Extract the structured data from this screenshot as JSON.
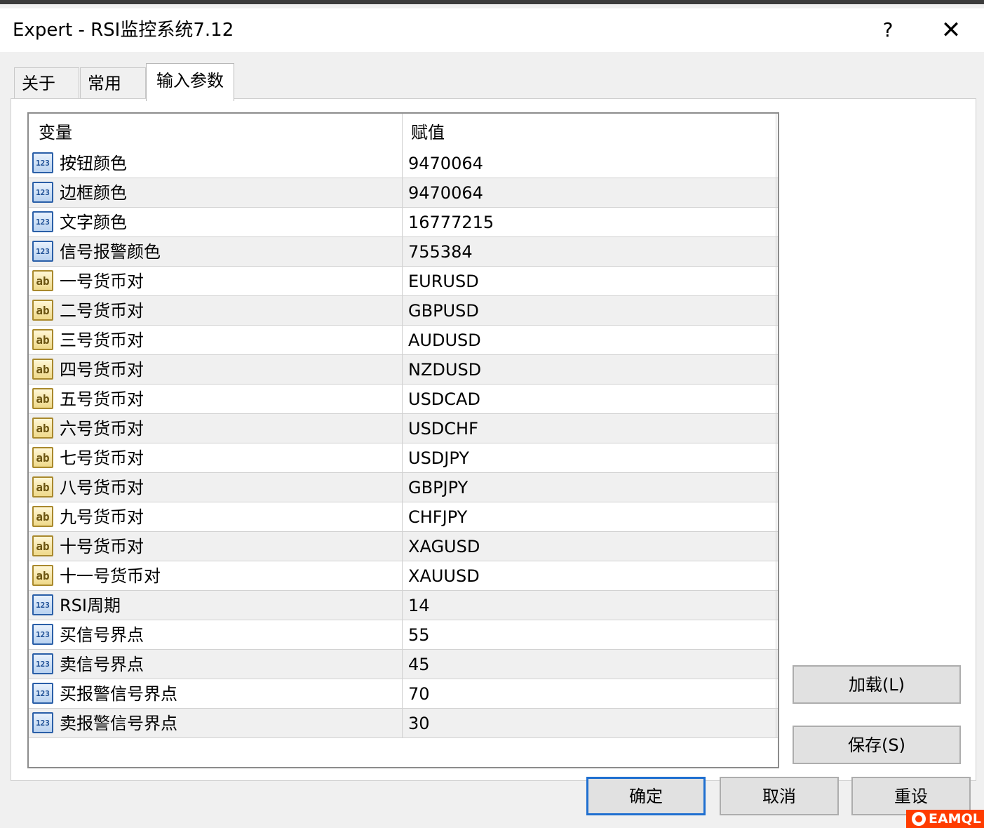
{
  "window": {
    "title": "Expert - RSI监控系统7.12",
    "help_label": "?",
    "close_label": "✕"
  },
  "tabs": [
    {
      "label": "关于"
    },
    {
      "label": "常用"
    },
    {
      "label": "输入参数",
      "active": true
    }
  ],
  "grid": {
    "columns": {
      "variable": "变量",
      "value": "赋值"
    },
    "rows": [
      {
        "type": "num",
        "icon": "123",
        "name": "按钮颜色",
        "value": "9470064"
      },
      {
        "type": "num",
        "icon": "123",
        "name": "边框颜色",
        "value": "9470064"
      },
      {
        "type": "num",
        "icon": "123",
        "name": "文字颜色",
        "value": "16777215"
      },
      {
        "type": "num",
        "icon": "123",
        "name": "信号报警颜色",
        "value": "755384"
      },
      {
        "type": "str",
        "icon": "ab",
        "name": "一号货币对",
        "value": "EURUSD"
      },
      {
        "type": "str",
        "icon": "ab",
        "name": "二号货币对",
        "value": "GBPUSD"
      },
      {
        "type": "str",
        "icon": "ab",
        "name": "三号货币对",
        "value": "AUDUSD"
      },
      {
        "type": "str",
        "icon": "ab",
        "name": "四号货币对",
        "value": "NZDUSD"
      },
      {
        "type": "str",
        "icon": "ab",
        "name": "五号货币对",
        "value": "USDCAD"
      },
      {
        "type": "str",
        "icon": "ab",
        "name": "六号货币对",
        "value": "USDCHF"
      },
      {
        "type": "str",
        "icon": "ab",
        "name": "七号货币对",
        "value": "USDJPY"
      },
      {
        "type": "str",
        "icon": "ab",
        "name": "八号货币对",
        "value": "GBPJPY"
      },
      {
        "type": "str",
        "icon": "ab",
        "name": "九号货币对",
        "value": "CHFJPY"
      },
      {
        "type": "str",
        "icon": "ab",
        "name": "十号货币对",
        "value": "XAGUSD"
      },
      {
        "type": "str",
        "icon": "ab",
        "name": "十一号货币对",
        "value": "XAUUSD"
      },
      {
        "type": "num",
        "icon": "123",
        "name": "RSI周期",
        "value": "14"
      },
      {
        "type": "num",
        "icon": "123",
        "name": "买信号界点",
        "value": "55"
      },
      {
        "type": "num",
        "icon": "123",
        "name": "卖信号界点",
        "value": "45"
      },
      {
        "type": "num",
        "icon": "123",
        "name": "买报警信号界点",
        "value": "70"
      },
      {
        "type": "num",
        "icon": "123",
        "name": "卖报警信号界点",
        "value": "30"
      }
    ]
  },
  "buttons": {
    "load": "加载(L)",
    "save": "保存(S)",
    "ok": "确定",
    "cancel": "取消",
    "reset": "重设"
  },
  "watermark": {
    "text": "EAMQL"
  },
  "colors": {
    "ok_border": "#1f6fd0",
    "watermark_bg": "#ff3c00"
  }
}
